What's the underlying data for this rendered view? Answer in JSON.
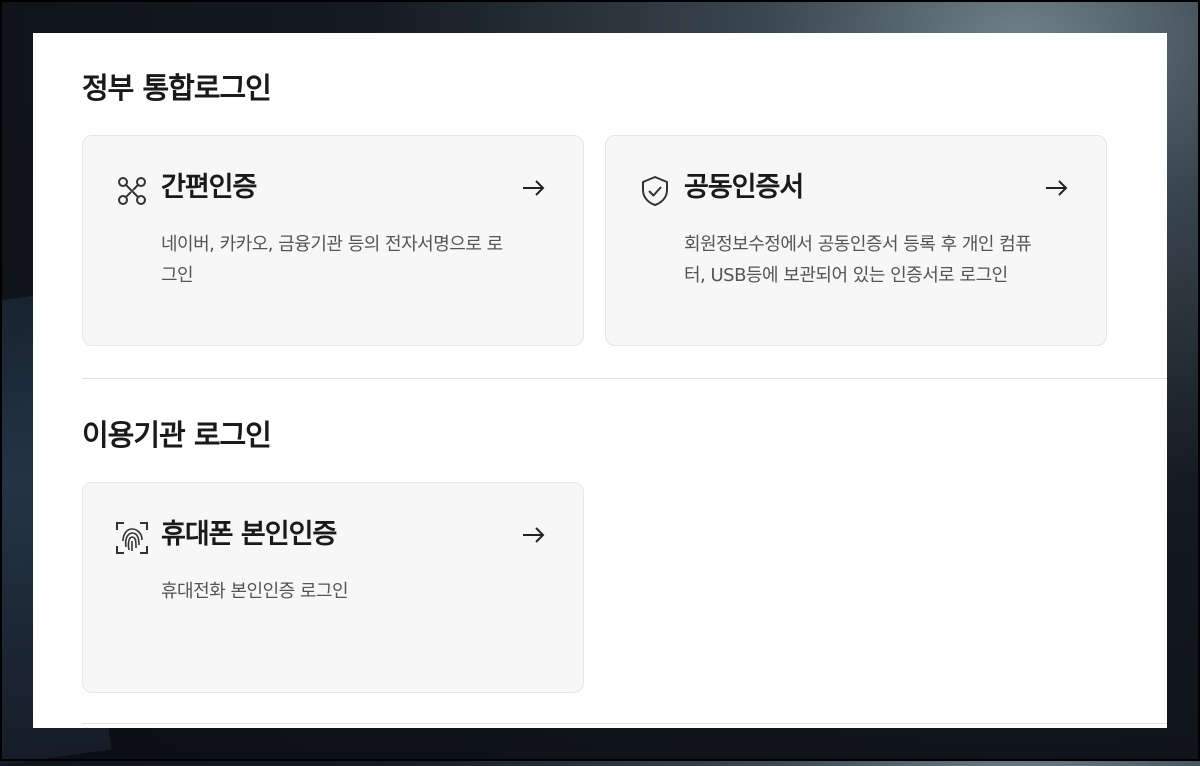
{
  "government_login": {
    "title": "정부 통합로그인",
    "cards": [
      {
        "title": "간편인증",
        "description": "네이버, 카카오, 금융기관 등의 전자서명으로 로그인",
        "icon": "simple-auth-icon",
        "arrow_icon": "arrow-right-icon"
      },
      {
        "title": "공동인증서",
        "description": "회원정보수정에서 공동인증서 등록 후 개인 컴퓨터, USB등에 보관되어 있는 인증서로 로그인",
        "icon": "shield-check-icon",
        "arrow_icon": "arrow-right-icon"
      }
    ]
  },
  "institution_login": {
    "title": "이용기관 로그인",
    "cards": [
      {
        "title": "휴대폰 본인인증",
        "description": "휴대전화 본인인증 로그인",
        "icon": "fingerprint-scan-icon",
        "arrow_icon": "arrow-right-icon"
      }
    ]
  }
}
